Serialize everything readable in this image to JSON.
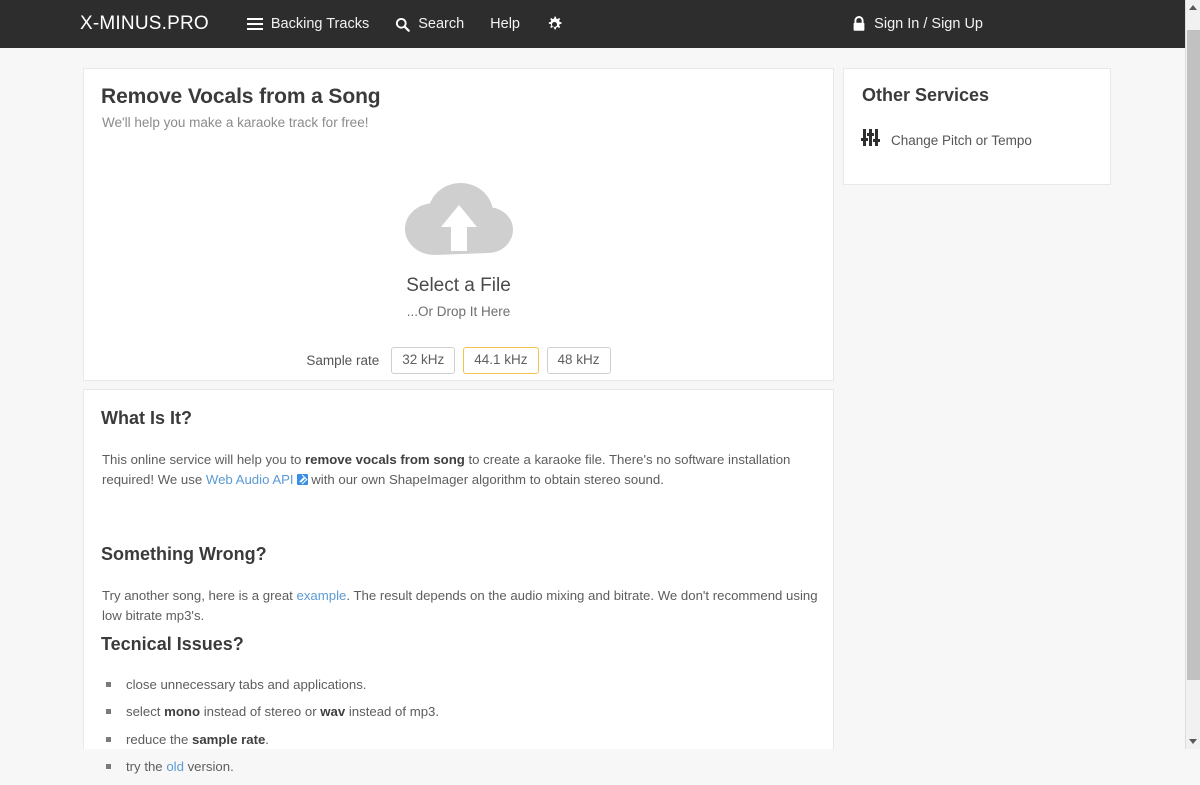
{
  "header": {
    "brand": "X-MINUS.PRO",
    "nav": [
      {
        "label": "Backing Tracks",
        "icon": "hamburger-icon"
      },
      {
        "label": "Search",
        "icon": "search-icon"
      },
      {
        "label": "Help",
        "icon": ""
      },
      {
        "label": "",
        "icon": "gear-icon"
      }
    ],
    "account_label": "Sign In / Sign Up",
    "account_icon": "lock-icon",
    "background_color": "#2d2d2d"
  },
  "main": {
    "title": "Remove Vocals from a Song",
    "subtitle": "We'll help you make a karaoke track for free!",
    "upload": {
      "icon": "cloud-upload-icon",
      "primary": "Select a File",
      "secondary": "...Or Drop It Here"
    },
    "sample_rate": {
      "label": "Sample rate",
      "options": [
        "32 kHz",
        "44.1 kHz",
        "48 kHz"
      ],
      "selected": "44.1 kHz",
      "selected_border_color": "#f2c14e"
    }
  },
  "sidebar": {
    "title": "Other Services",
    "items": [
      {
        "label": "Change Pitch or Tempo",
        "icon": "sliders-icon"
      }
    ]
  },
  "info": {
    "what_is_it": {
      "heading": "What Is It?",
      "text_1": "This online service will help you to ",
      "bold_1": "remove vocals from song",
      "text_2": " to create a karaoke file. There's no software installation required! We use ",
      "link_1": "Web Audio API",
      "link_1_icon": "external-link-icon",
      "text_3": " with our own ShapeImager algorithm to obtain stereo sound."
    },
    "something_wrong": {
      "heading": "Something Wrong?",
      "text_1": "Try another song, here is a great ",
      "link_1": "example",
      "text_2": ". The result depends on the audio mixing and bitrate. We don't recommend using low bitrate mp3's."
    },
    "technical_issues": {
      "heading": "Tecnical Issues?",
      "bullets": [
        {
          "pre": "close unnecessary tabs and applications.",
          "bold": "",
          "post": ""
        },
        {
          "pre": "select ",
          "bold": "mono",
          "mid": " instead of stereo or ",
          "bold2": "wav",
          "post": " instead of mp3."
        },
        {
          "pre": "reduce the ",
          "bold": "sample rate",
          "post": "."
        },
        {
          "pre": "try the ",
          "link": "old",
          "post": " version."
        }
      ]
    }
  },
  "scrollbar": {
    "position": "right",
    "thumb_visible": true
  }
}
